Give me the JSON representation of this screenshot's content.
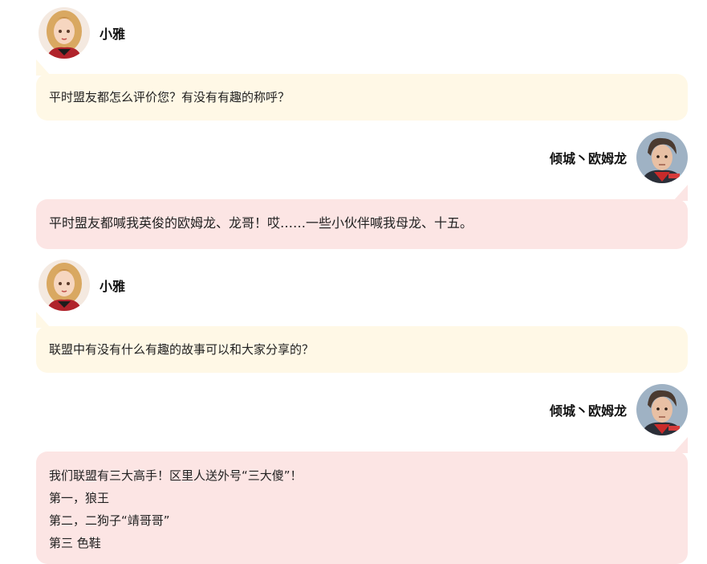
{
  "messages": [
    {
      "speaker": "小雅",
      "side": "left",
      "avatar": "girl-avatar-icon",
      "lines": [
        "平时盟友都怎么评价您？有没有有趣的称呼？"
      ]
    },
    {
      "speaker": "倾城丶欧姆龙",
      "side": "right",
      "avatar": "warrior-avatar-icon",
      "lines": [
        "平时盟友都喊我英俊的欧姆龙、龙哥！哎……一些小伙伴喊我母龙、十五。"
      ]
    },
    {
      "speaker": "小雅",
      "side": "left",
      "avatar": "girl-avatar-icon",
      "lines": [
        "联盟中有没有什么有趣的故事可以和大家分享的？"
      ]
    },
    {
      "speaker": "倾城丶欧姆龙",
      "side": "right",
      "avatar": "warrior-avatar-icon",
      "lines": [
        "我们联盟有三大高手！区里人送外号“三大傻”！",
        "第一，狼王",
        "第二，二狗子“靖哥哥”",
        "第三   色鞋"
      ]
    }
  ],
  "colors": {
    "host_bubble": "#fff8e6",
    "guest_bubble": "#fce5e4"
  }
}
